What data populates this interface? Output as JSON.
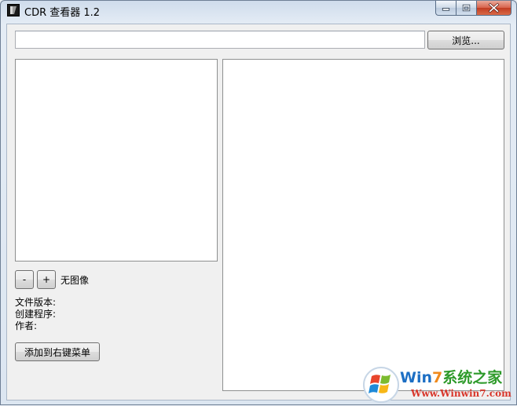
{
  "window": {
    "title": "CDR 查看器 1.2",
    "icons": {
      "app": "cdr-app-icon",
      "minimize": "minimize-icon",
      "maximize": "maximize-icon",
      "close": "close-icon"
    }
  },
  "toolbar": {
    "path_value": "",
    "browse_label": "浏览..."
  },
  "preview": {
    "zoom_out_label": "-",
    "zoom_in_label": "+",
    "image_status": "无图像"
  },
  "file_info": {
    "version_label": "文件版本:",
    "creator_label": "创建程序:",
    "author_label": "作者:"
  },
  "actions": {
    "add_context_menu_label": "添加到右键菜单"
  },
  "watermark": {
    "brand_prefix": "Win",
    "brand_digit": "7",
    "brand_suffix": "系统之家",
    "url": "Www.Winwin7.com",
    "colors": {
      "blue": "#1d6fc4",
      "green": "#2e9a2a",
      "red": "#d8372b",
      "orange": "#f08a1c"
    }
  }
}
